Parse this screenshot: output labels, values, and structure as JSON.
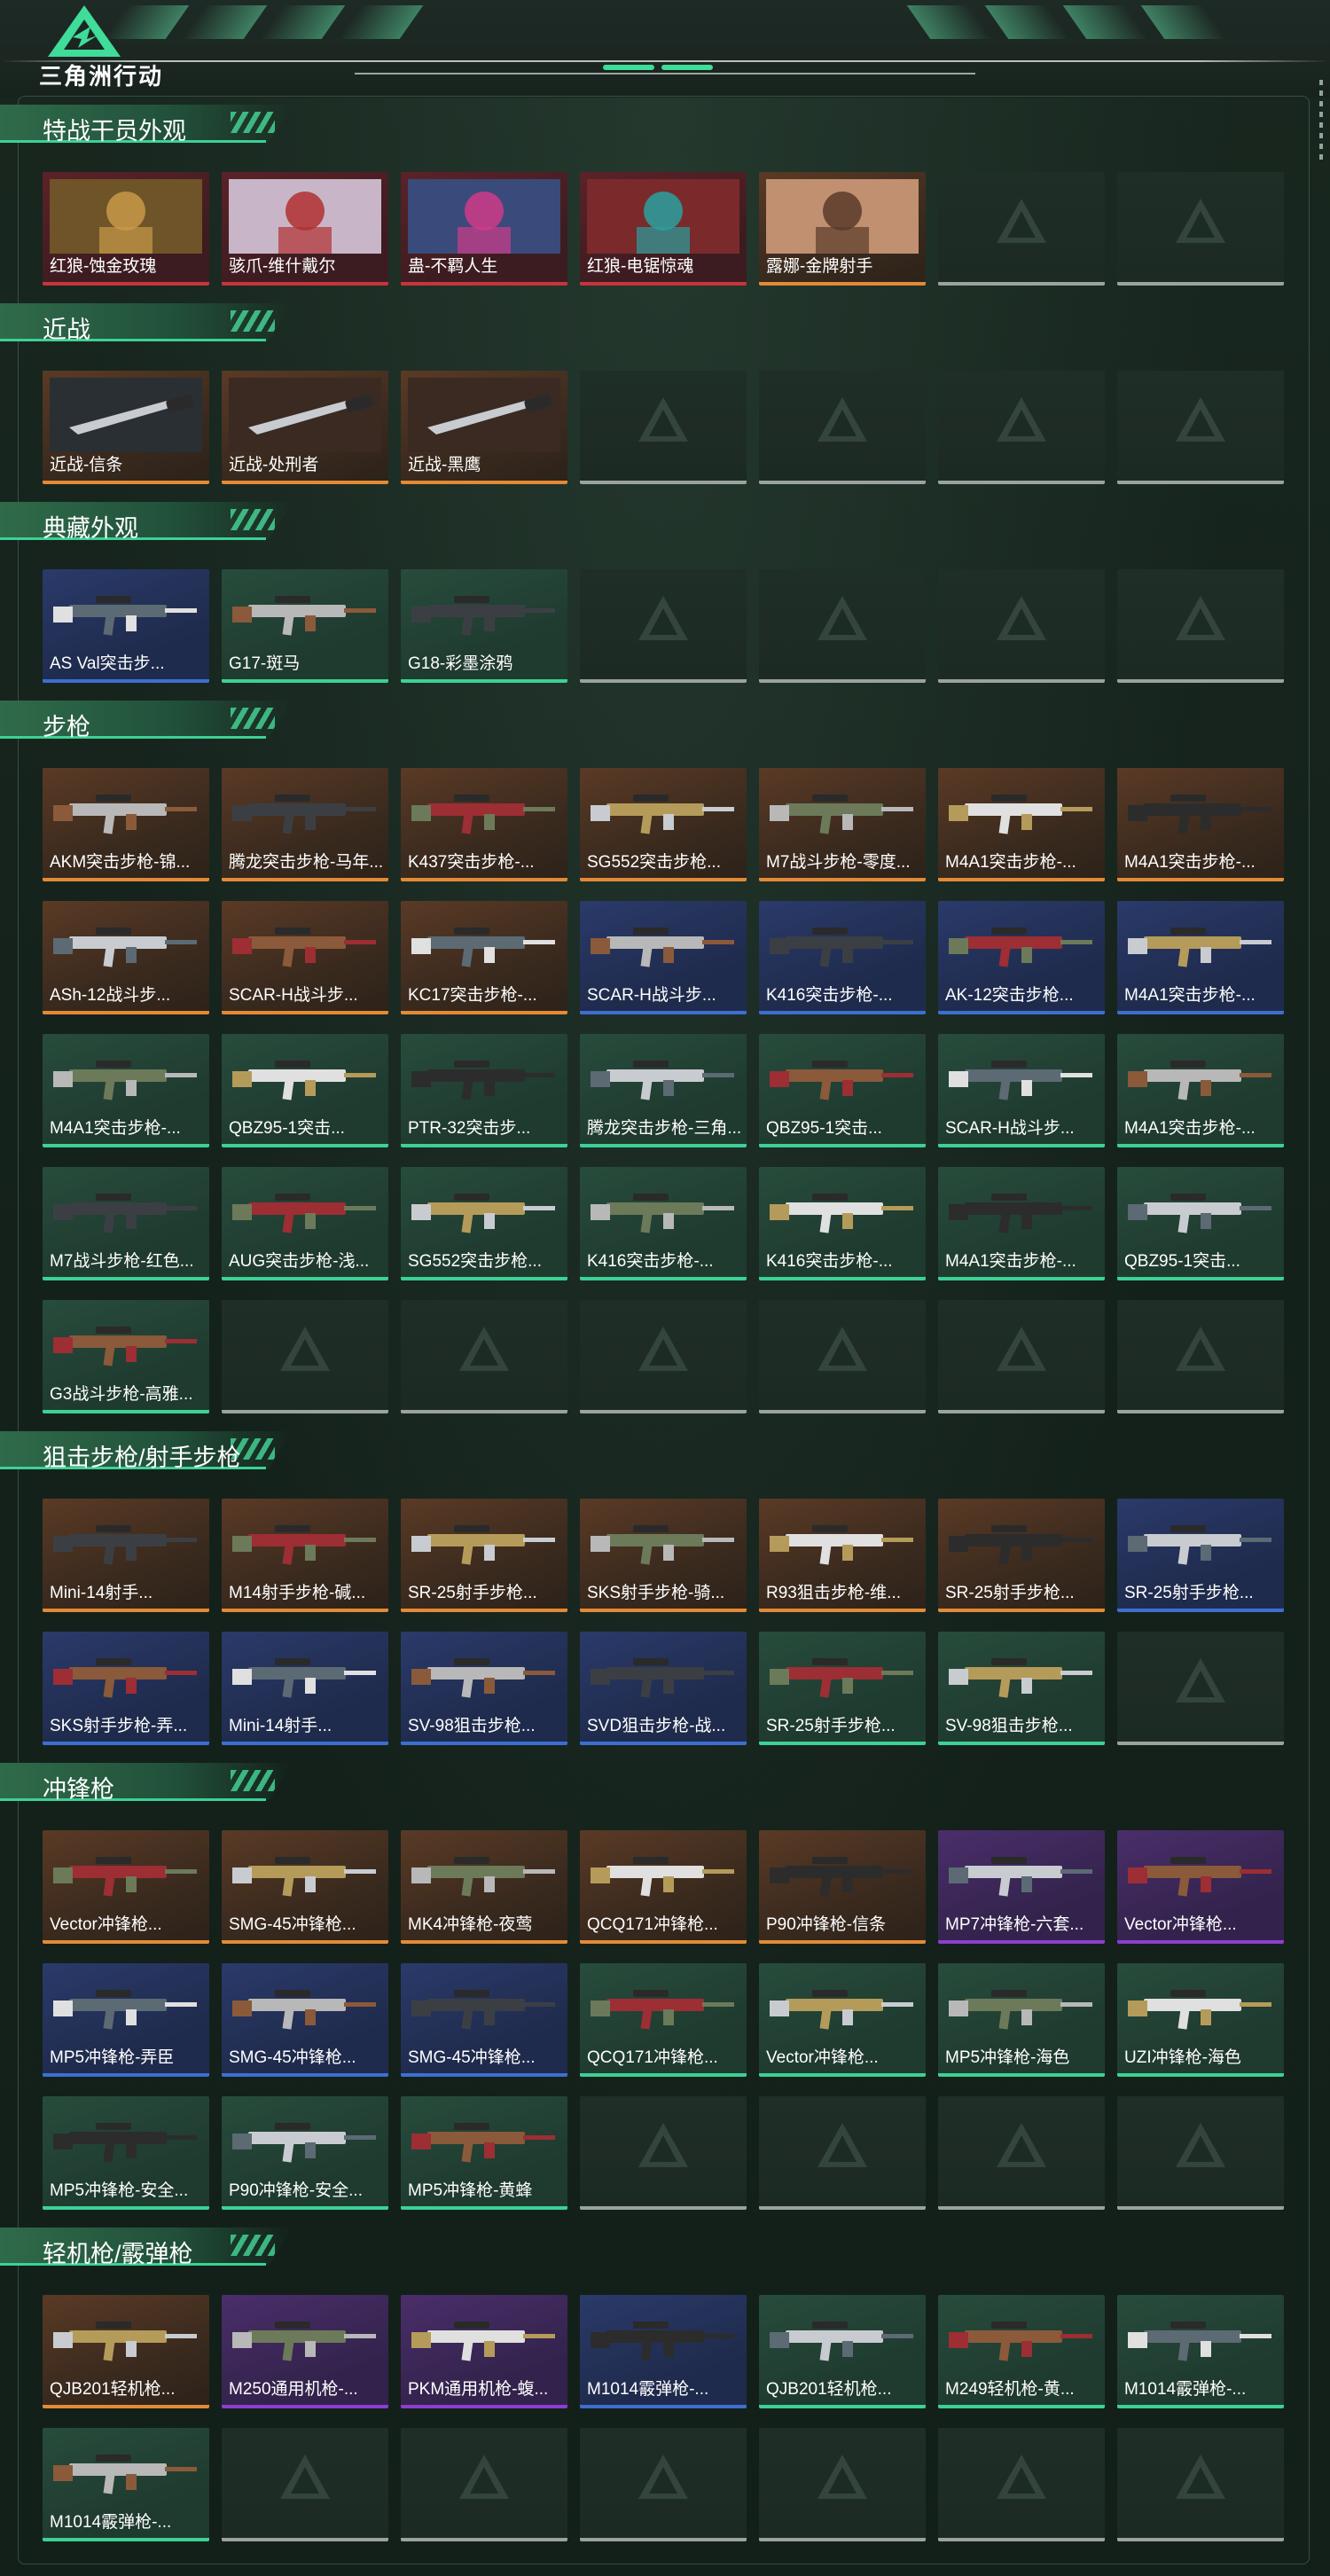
{
  "header": {
    "brand": "三角洲行动"
  },
  "colors": {
    "accent": "#3cd195",
    "orange": "#e38a36",
    "red": "#c8343c",
    "blue": "#3d6fd0",
    "green": "#3cd195",
    "purple": "#8b3fd0"
  },
  "sections": [
    {
      "title": "特战干员外观",
      "rows": 1,
      "items": [
        {
          "name": "红狼-蚀金玫瑰",
          "rarity": "red"
        },
        {
          "name": "骇爪-维什戴尔",
          "rarity": "red"
        },
        {
          "name": "蛊-不羁人生",
          "rarity": "red"
        },
        {
          "name": "红狼-电锯惊魂",
          "rarity": "red"
        },
        {
          "name": "露娜-金牌射手",
          "rarity": "orange"
        }
      ]
    },
    {
      "title": "近战",
      "rows": 1,
      "items": [
        {
          "name": "近战-信条",
          "rarity": "orange"
        },
        {
          "name": "近战-处刑者",
          "rarity": "orange"
        },
        {
          "name": "近战-黑鹰",
          "rarity": "orange"
        }
      ]
    },
    {
      "title": "典藏外观",
      "rows": 1,
      "items": [
        {
          "name": "AS Val突击步...",
          "rarity": "blue"
        },
        {
          "name": "G17-斑马",
          "rarity": "green"
        },
        {
          "name": "G18-彩墨涂鸦",
          "rarity": "green"
        }
      ]
    },
    {
      "title": "步枪",
      "rows": 5,
      "items": [
        {
          "name": "AKM突击步枪-锦...",
          "rarity": "orange"
        },
        {
          "name": "腾龙突击步枪-马年...",
          "rarity": "orange"
        },
        {
          "name": "K437突击步枪-...",
          "rarity": "orange"
        },
        {
          "name": "SG552突击步枪...",
          "rarity": "orange"
        },
        {
          "name": "M7战斗步枪-零度...",
          "rarity": "orange"
        },
        {
          "name": "M4A1突击步枪-...",
          "rarity": "orange"
        },
        {
          "name": "M4A1突击步枪-...",
          "rarity": "orange"
        },
        {
          "name": "ASh-12战斗步...",
          "rarity": "orange"
        },
        {
          "name": "SCAR-H战斗步...",
          "rarity": "orange"
        },
        {
          "name": "KC17突击步枪-...",
          "rarity": "orange"
        },
        {
          "name": "SCAR-H战斗步...",
          "rarity": "blue"
        },
        {
          "name": "K416突击步枪-...",
          "rarity": "blue"
        },
        {
          "name": "AK-12突击步枪...",
          "rarity": "blue"
        },
        {
          "name": "M4A1突击步枪-...",
          "rarity": "blue"
        },
        {
          "name": "M4A1突击步枪-...",
          "rarity": "green"
        },
        {
          "name": "QBZ95-1突击...",
          "rarity": "green"
        },
        {
          "name": "PTR-32突击步...",
          "rarity": "green"
        },
        {
          "name": "腾龙突击步枪-三角...",
          "rarity": "green"
        },
        {
          "name": "QBZ95-1突击...",
          "rarity": "green"
        },
        {
          "name": "SCAR-H战斗步...",
          "rarity": "green"
        },
        {
          "name": "M4A1突击步枪-...",
          "rarity": "green"
        },
        {
          "name": "M7战斗步枪-红色...",
          "rarity": "green"
        },
        {
          "name": "AUG突击步枪-浅...",
          "rarity": "green"
        },
        {
          "name": "SG552突击步枪...",
          "rarity": "green"
        },
        {
          "name": "K416突击步枪-...",
          "rarity": "green"
        },
        {
          "name": "K416突击步枪-...",
          "rarity": "green"
        },
        {
          "name": "M4A1突击步枪-...",
          "rarity": "green"
        },
        {
          "name": "QBZ95-1突击...",
          "rarity": "green"
        },
        {
          "name": "G3战斗步枪-高雅...",
          "rarity": "green"
        }
      ]
    },
    {
      "title": "狙击步枪/射手步枪",
      "rows": 2,
      "items": [
        {
          "name": "Mini-14射手...",
          "rarity": "orange"
        },
        {
          "name": "M14射手步枪-碱...",
          "rarity": "orange"
        },
        {
          "name": "SR-25射手步枪...",
          "rarity": "orange"
        },
        {
          "name": "SKS射手步枪-骑...",
          "rarity": "orange"
        },
        {
          "name": "R93狙击步枪-维...",
          "rarity": "orange"
        },
        {
          "name": "SR-25射手步枪...",
          "rarity": "orange"
        },
        {
          "name": "SR-25射手步枪...",
          "rarity": "blue"
        },
        {
          "name": "SKS射手步枪-弄...",
          "rarity": "blue"
        },
        {
          "name": "Mini-14射手...",
          "rarity": "blue"
        },
        {
          "name": "SV-98狙击步枪...",
          "rarity": "blue"
        },
        {
          "name": "SVD狙击步枪-战...",
          "rarity": "blue"
        },
        {
          "name": "SR-25射手步枪...",
          "rarity": "green"
        },
        {
          "name": "SV-98狙击步枪...",
          "rarity": "green"
        }
      ]
    },
    {
      "title": "冲锋枪",
      "rows": 3,
      "items": [
        {
          "name": "Vector冲锋枪...",
          "rarity": "orange"
        },
        {
          "name": "SMG-45冲锋枪...",
          "rarity": "orange"
        },
        {
          "name": "MK4冲锋枪-夜莺",
          "rarity": "orange"
        },
        {
          "name": "QCQ171冲锋枪...",
          "rarity": "orange"
        },
        {
          "name": "P90冲锋枪-信条",
          "rarity": "orange"
        },
        {
          "name": "MP7冲锋枪-六套...",
          "rarity": "purple"
        },
        {
          "name": "Vector冲锋枪...",
          "rarity": "purple"
        },
        {
          "name": "MP5冲锋枪-弄臣",
          "rarity": "blue"
        },
        {
          "name": "SMG-45冲锋枪...",
          "rarity": "blue"
        },
        {
          "name": "SMG-45冲锋枪...",
          "rarity": "blue"
        },
        {
          "name": "QCQ171冲锋枪...",
          "rarity": "green"
        },
        {
          "name": "Vector冲锋枪...",
          "rarity": "green"
        },
        {
          "name": "MP5冲锋枪-海色",
          "rarity": "green"
        },
        {
          "name": "UZI冲锋枪-海色",
          "rarity": "green"
        },
        {
          "name": "MP5冲锋枪-安全...",
          "rarity": "green"
        },
        {
          "name": "P90冲锋枪-安全...",
          "rarity": "green"
        },
        {
          "name": "MP5冲锋枪-黄蜂",
          "rarity": "green"
        }
      ]
    },
    {
      "title": "轻机枪/霰弹枪",
      "rows": 2,
      "items": [
        {
          "name": "QJB201轻机枪...",
          "rarity": "orange"
        },
        {
          "name": "M250通用机枪-...",
          "rarity": "purple"
        },
        {
          "name": "PKM通用机枪-蝮...",
          "rarity": "purple"
        },
        {
          "name": "M1014霰弹枪-...",
          "rarity": "blue"
        },
        {
          "name": "QJB201轻机枪...",
          "rarity": "green"
        },
        {
          "name": "M249轻机枪-黄...",
          "rarity": "green"
        },
        {
          "name": "M1014霰弹枪-...",
          "rarity": "green"
        },
        {
          "name": "M1014霰弹枪-...",
          "rarity": "green"
        }
      ]
    }
  ]
}
